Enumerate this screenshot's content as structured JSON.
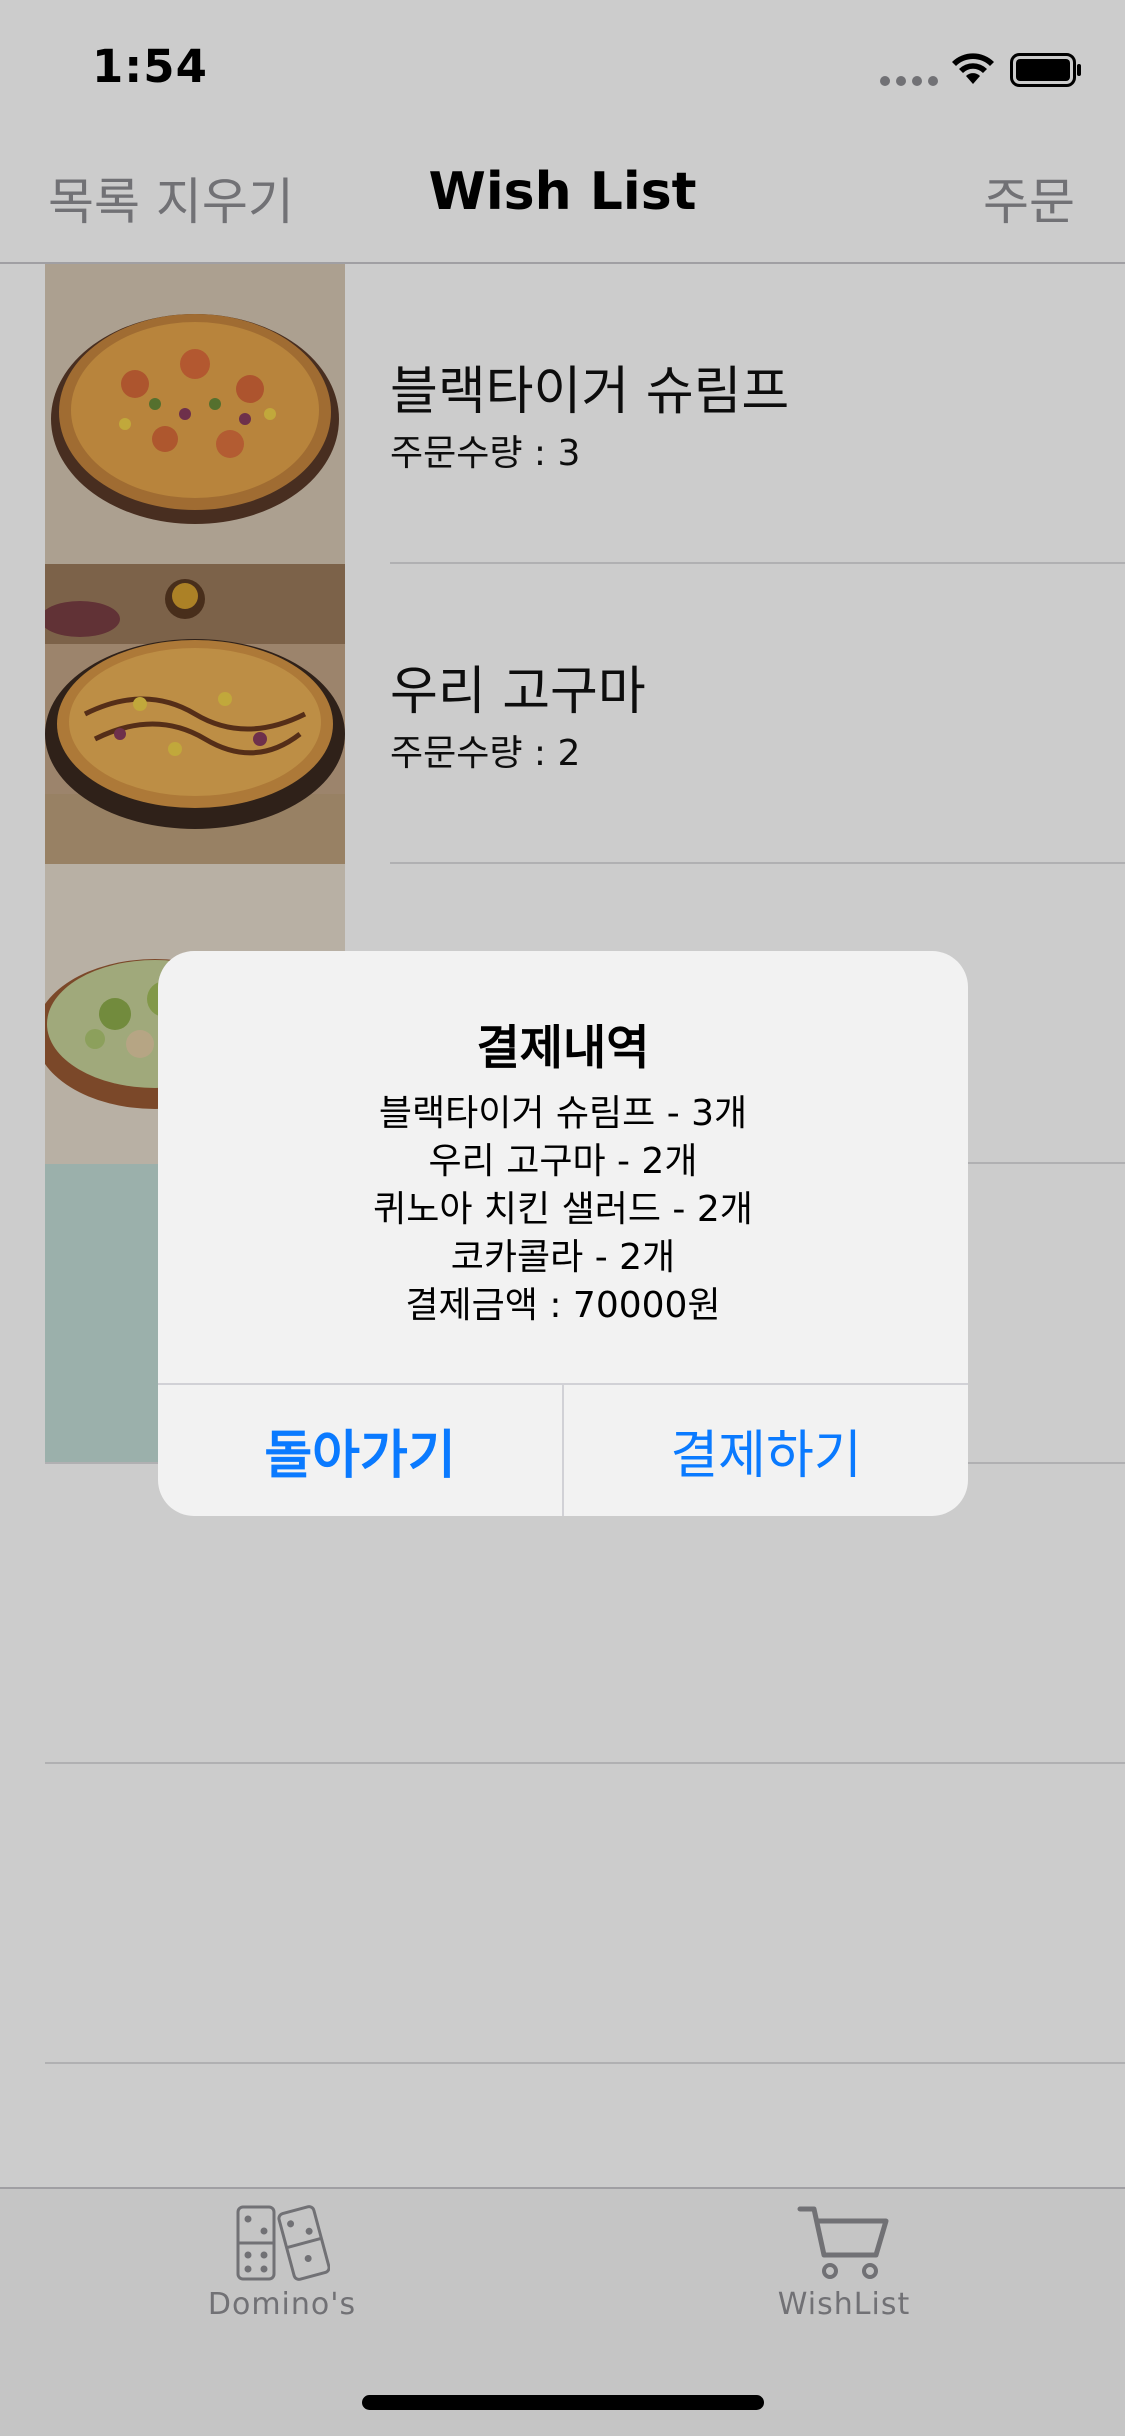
{
  "status_bar": {
    "time": "1:54",
    "icons": [
      "cellular-signal-icon",
      "wifi-icon",
      "battery-icon"
    ]
  },
  "nav": {
    "left_button": "목록 지우기",
    "title": "Wish List",
    "right_button": "주문"
  },
  "list": {
    "items": [
      {
        "name": "블랙타이거 슈림프",
        "quantity": "주문수량 : 3"
      },
      {
        "name": "우리 고구마",
        "quantity": "주문수량 : 2"
      },
      {
        "name": "",
        "quantity": ""
      },
      {
        "name": "",
        "quantity": ""
      }
    ]
  },
  "alert": {
    "title": "결제내역",
    "lines": [
      "블랙타이거 슈림프 - 3개",
      "우리 고구마 - 2개",
      "퀴노아 치킨 샐러드 - 2개",
      "코카콜라 - 2개",
      "결제금액 : 70000원"
    ],
    "cancel_label": "돌아가기",
    "confirm_label": "결제하기"
  },
  "tab_bar": {
    "tabs": [
      {
        "label": "Domino's",
        "icon": "dominos-icon"
      },
      {
        "label": "WishList",
        "icon": "cart-icon"
      }
    ]
  },
  "colors": {
    "accent": "#0a7aff",
    "inactive": "#8e8e93",
    "teal_thumb": "#c2dcd6"
  }
}
